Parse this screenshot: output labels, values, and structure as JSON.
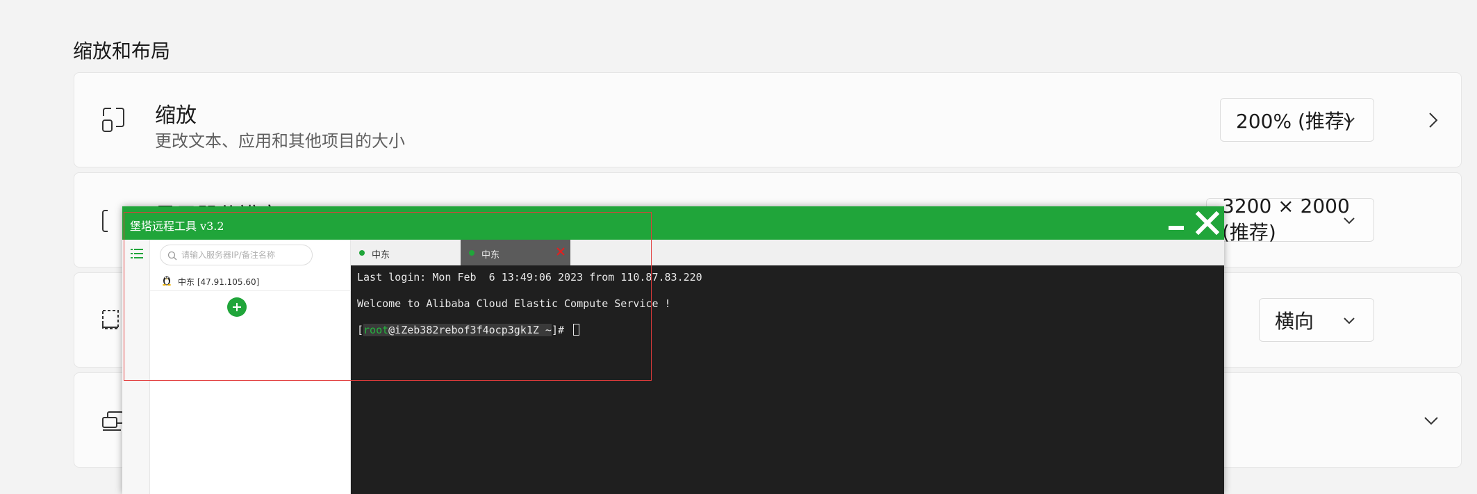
{
  "settings": {
    "section_title": "缩放和布局",
    "scale": {
      "title": "缩放",
      "subtitle": "更改文本、应用和其他项目的大小",
      "value": "200% (推荐)"
    },
    "resolution": {
      "title": "显示器分辨率",
      "value": "3200 × 2000 (推荐)"
    },
    "orientation": {
      "value": "横向"
    }
  },
  "app": {
    "title": "堡塔远程工具 v3.2",
    "search_placeholder": "请输入服务器IP/备注名称",
    "server_label": "中东 [47.91.105.60]",
    "tabs": [
      {
        "label": "中东"
      },
      {
        "label": "中东"
      }
    ],
    "terminal": {
      "line1": "Last login: Mon Feb  6 13:49:06 2023 from 110.87.83.220",
      "line2": "Welcome to Alibaba Cloud Elastic Compute Service !",
      "prompt_open": "[",
      "prompt_user": "root",
      "prompt_host": "@iZeb382rebof3f4ocp3gk1Z ~",
      "prompt_close": "]# "
    },
    "accent_color": "#20a53a"
  },
  "icons": [
    "scale-icon",
    "resolution-icon",
    "orientation-icon",
    "multi-display-icon",
    "chevron-down-icon",
    "chevron-right-icon",
    "menu-icon",
    "search-icon",
    "linux-icon",
    "add-icon",
    "close-icon",
    "minimize-icon"
  ]
}
